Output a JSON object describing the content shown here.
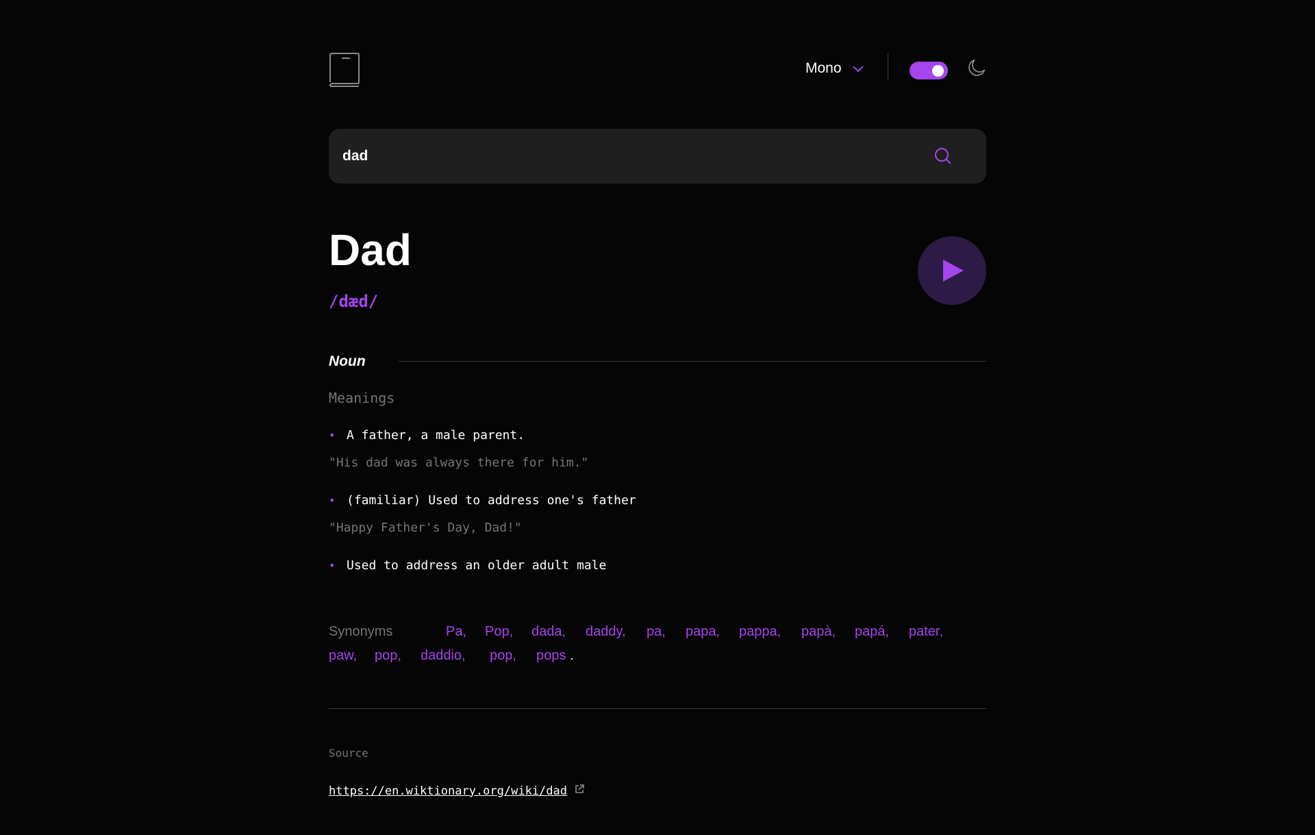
{
  "header": {
    "font_selector": {
      "selected": "Mono"
    },
    "theme": {
      "dark_mode": true
    }
  },
  "search": {
    "value": "dad",
    "placeholder": ""
  },
  "entry": {
    "word": "Dad",
    "phonetic": "/dæd/"
  },
  "meaning": {
    "part_of_speech": "Noun",
    "heading": "Meanings",
    "definitions": [
      {
        "text": "A father, a male parent.",
        "example": "\"His dad was always there for him.\""
      },
      {
        "text": "(familiar) Used to address one's father",
        "example": "\"Happy Father's Day, Dad!\""
      },
      {
        "text": "Used to address an older adult male",
        "example": ""
      }
    ],
    "synonyms_label": "Synonyms",
    "synonyms": [
      "Pa,",
      "Pop,",
      "dada,",
      "daddy,",
      "pa,",
      "papa,",
      "pappa,",
      "papà,",
      "papá,",
      "pater,",
      "paw,",
      "pop,",
      "daddio,",
      "pop,",
      "pops"
    ],
    "synonyms_end": "."
  },
  "source": {
    "label": "Source",
    "url": "https://en.wiktionary.org/wiki/dad"
  },
  "colors": {
    "accent": "#a445ed",
    "background": "#050505",
    "muted": "#757575"
  },
  "icons": [
    "book-logo-icon",
    "chevron-down-icon",
    "moon-icon",
    "search-icon",
    "play-icon",
    "external-link-icon"
  ]
}
